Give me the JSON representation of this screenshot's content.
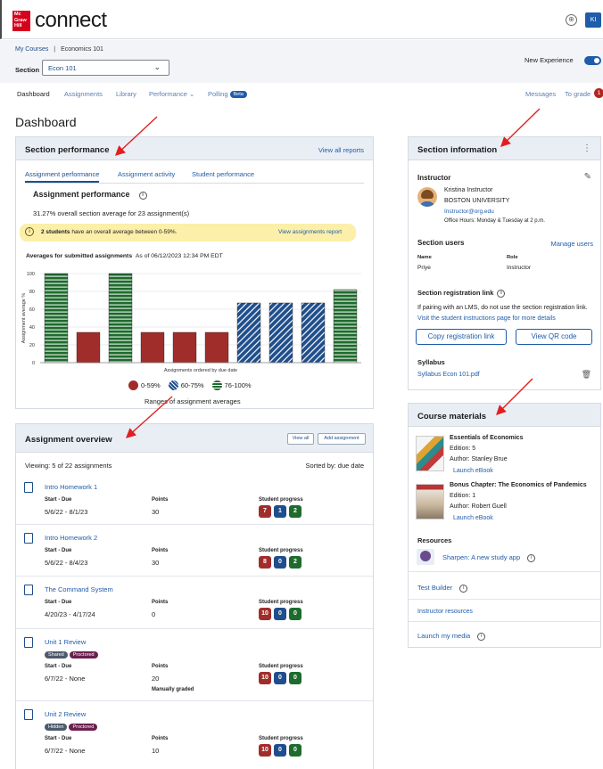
{
  "header": {
    "logo_text": "Mc Graw Hill",
    "brand": "connect",
    "avatar_initials": "KI"
  },
  "breadcrumb": {
    "my_courses": "My Courses",
    "separator": "|",
    "course": "Economics 101"
  },
  "section": {
    "label": "Section",
    "selected": "Econ 101"
  },
  "new_experience_label": "New Experience",
  "nav": {
    "items": [
      "Dashboard",
      "Assignments",
      "Library",
      "Performance",
      "Polling"
    ],
    "beta": "Beta",
    "messages": "Messages",
    "to_grade": "To grade",
    "to_grade_count": "1"
  },
  "page_title": "Dashboard",
  "section_performance": {
    "title": "Section performance",
    "view_all": "View all reports",
    "tabs": [
      "Assignment performance",
      "Assignment activity",
      "Student performance"
    ],
    "subtitle": "Assignment performance",
    "average_text": "31.27% overall section average for 23 assignment(s)",
    "alert_bold": "2 students",
    "alert_rest": "have an overall average between 0-59%.",
    "alert_link": "View assignments report",
    "chart_heading": "Averages for submitted assignments",
    "chart_asof": "As of 06/12/2023 12:34 PM EDT",
    "legend_title": "Ranges of assignment averages"
  },
  "chart_data": {
    "type": "bar",
    "xlabel": "Assignments ordered by due date",
    "ylabel": "Assignment average %",
    "ylim": [
      0,
      100
    ],
    "yticks": [
      0,
      20,
      40,
      60,
      80,
      100
    ],
    "values": [
      100,
      34,
      100,
      34,
      34,
      34,
      67,
      67,
      67,
      82
    ],
    "ranges": [
      "green",
      "red",
      "green",
      "red",
      "red",
      "red",
      "blue",
      "blue",
      "blue",
      "green"
    ],
    "legend": [
      {
        "label": "0-59%",
        "color": "#a12d2a"
      },
      {
        "label": "60-75%",
        "color": "#1f4e8c"
      },
      {
        "label": "76-100%",
        "color": "#1e6b2d"
      }
    ]
  },
  "assignment_overview": {
    "title": "Assignment overview",
    "view_all": "View all",
    "add_assignment": "Add assignment",
    "viewing": "Viewing: 5 of 22 assignments",
    "sorted": "Sorted by: due date",
    "col_start_due": "Start - Due",
    "col_points": "Points",
    "col_progress": "Student progress",
    "items": [
      {
        "name": "Intro Homework 1",
        "dates": "5/6/22 - 8/1/23",
        "points": "30",
        "note": "",
        "tags": [],
        "progress": [
          "7",
          "1",
          "2"
        ]
      },
      {
        "name": "Intro Homework 2",
        "dates": "5/6/22 - 8/4/23",
        "points": "30",
        "note": "",
        "tags": [],
        "progress": [
          "8",
          "0",
          "2"
        ]
      },
      {
        "name": "The Command System",
        "dates": "4/20/23 - 4/17/24",
        "points": "0",
        "note": "",
        "tags": [],
        "progress": [
          "10",
          "0",
          "0"
        ]
      },
      {
        "name": "Unit 1 Review",
        "dates": "6/7/22 - None",
        "points": "20",
        "note": "Manually graded",
        "tags": [
          "Shared",
          "Proctored"
        ],
        "progress": [
          "10",
          "0",
          "0"
        ]
      },
      {
        "name": "Unit 2 Review",
        "dates": "6/7/22 - None",
        "points": "10",
        "note": "",
        "tags": [
          "Hidden",
          "Proctored"
        ],
        "progress": [
          "10",
          "0",
          "0"
        ]
      }
    ]
  },
  "section_information": {
    "title": "Section information",
    "instructor_label": "Instructor",
    "instructor_name": "Kristina Instructor",
    "university": "BOSTON UNIVERSITY",
    "email": "Instructor@org.edu",
    "office_hours": "Office Hours: Monday & Tuesday at 2 p.m.",
    "users_label": "Section users",
    "manage_users": "Manage users",
    "col_name": "Name",
    "col_role": "Role",
    "user_name": "Priye",
    "user_role": "Instructor",
    "reg_label": "Section registration link",
    "reg_text_1": "If pairing with an LMS, do not use the section registration",
    "reg_text_2": "link.",
    "reg_link": "Visit the student instructions page for more details",
    "copy_btn": "Copy registration link",
    "qr_btn": "View QR code",
    "syllabus_label": "Syllabus",
    "syllabus_file": "Syllabus Econ 101.pdf"
  },
  "course_materials": {
    "title": "Course materials",
    "books": [
      {
        "title": "Essentials of Economics",
        "edition": "Edition: 5",
        "author": "Author: Stanley Brue",
        "action": "Launch eBook"
      },
      {
        "title": "Bonus Chapter: The Economics of Pandemics",
        "edition": "Edition: 1",
        "author": "Author: Robert Guell",
        "action": "Launch eBook"
      }
    ],
    "resources_label": "Resources",
    "sharpen": "Sharpen: A new study app",
    "test_builder": "Test Builder",
    "instructor_resources": "Instructor resources",
    "launch_media": "Launch my media"
  }
}
